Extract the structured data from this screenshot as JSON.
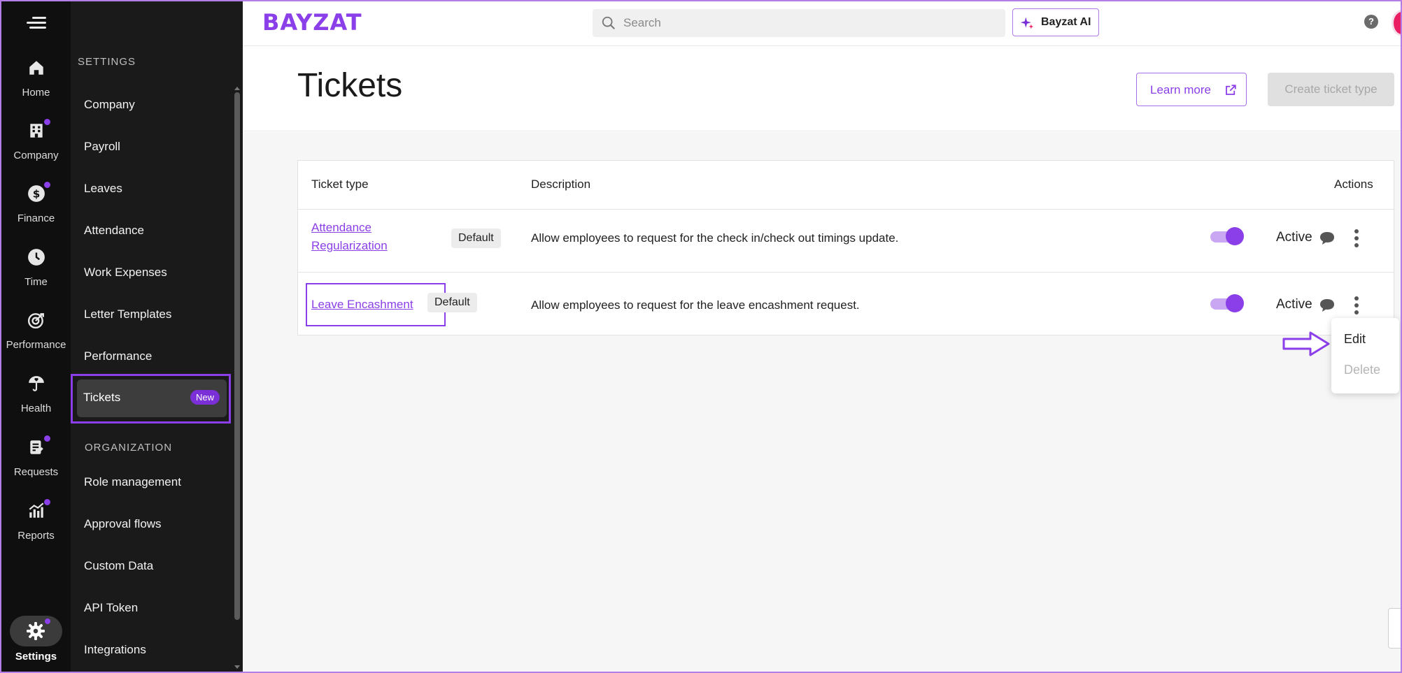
{
  "rail": {
    "items": [
      {
        "label": "Home",
        "icon": "home-icon",
        "dot": false
      },
      {
        "label": "Company",
        "icon": "building-icon",
        "dot": true
      },
      {
        "label": "Finance",
        "icon": "dollar-icon",
        "dot": true
      },
      {
        "label": "Time",
        "icon": "clock-icon",
        "dot": false
      },
      {
        "label": "Performance",
        "icon": "target-icon",
        "dot": false
      },
      {
        "label": "Health",
        "icon": "umbrella-heart-icon",
        "dot": false
      },
      {
        "label": "Requests",
        "icon": "clipboard-icon",
        "dot": true
      },
      {
        "label": "Reports",
        "icon": "chart-icon",
        "dot": true
      }
    ],
    "settings_label": "Settings"
  },
  "sidebar": {
    "section_settings": "SETTINGS",
    "settings_items": [
      "Company",
      "Payroll",
      "Leaves",
      "Attendance",
      "Work Expenses",
      "Letter Templates",
      "Performance"
    ],
    "active_item": {
      "label": "Tickets",
      "badge": "New"
    },
    "section_organization": "ORGANIZATION",
    "organization_items": [
      "Role management",
      "Approval flows",
      "Custom Data",
      "API Token",
      "Integrations"
    ]
  },
  "topbar": {
    "logo": "BAYZAT",
    "search_placeholder": "Search",
    "ai_button": "Bayzat AI",
    "help": "?"
  },
  "page": {
    "title": "Tickets",
    "learn_more": "Learn more",
    "create_button": "Create ticket type"
  },
  "table": {
    "headers": {
      "type": "Ticket type",
      "description": "Description",
      "actions": "Actions"
    },
    "rows": [
      {
        "type_line1": "Attendance",
        "type_line2": "Regularization",
        "tag": "Default",
        "description": "Allow employees to request for the check in/check out timings update.",
        "status": "Active"
      },
      {
        "type_line1": "Leave Encashment",
        "tag": "Default",
        "description": "Allow employees to request for the leave encashment request.",
        "status": "Active"
      }
    ]
  },
  "dropdown": {
    "edit": "Edit",
    "delete": "Delete"
  },
  "colors": {
    "accent": "#8b3fe8",
    "rail_bg": "#0f0f0f",
    "sidebar_bg": "#1a1a1a"
  }
}
